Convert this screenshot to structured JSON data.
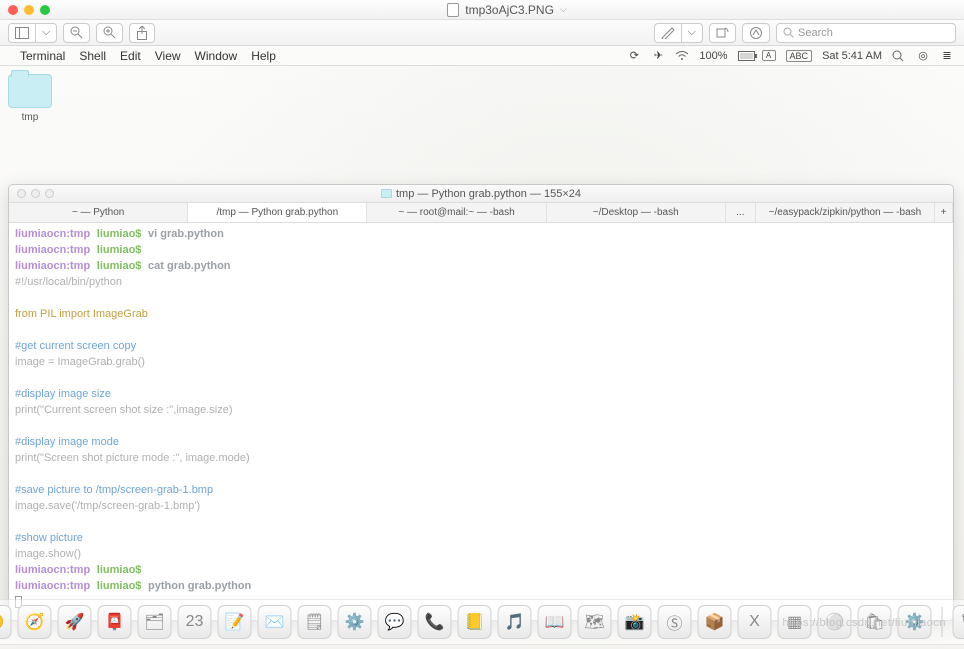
{
  "preview_window": {
    "title": "tmp3oAjC3.PNG",
    "search_placeholder": "Search"
  },
  "menubar": {
    "items": [
      "Terminal",
      "Shell",
      "Edit",
      "View",
      "Window",
      "Help"
    ],
    "battery": "100%",
    "input_badge": "ABC",
    "clock": "Sat 5:41 AM"
  },
  "desktop": {
    "folder_label": "tmp"
  },
  "terminal_window": {
    "title": "tmp — Python grab.python — 155×24",
    "tabs": [
      {
        "label": "~ — Python",
        "active": false
      },
      {
        "label": "/tmp — Python grab.python",
        "active": true
      },
      {
        "label": "~ — root@mail:~ — -bash",
        "active": false
      },
      {
        "label": "~/Desktop — -bash",
        "active": false
      },
      {
        "label": "...",
        "active": false
      },
      {
        "label": "~/easypack/zipkin/python — -bash",
        "active": false
      }
    ],
    "prompt": {
      "host_path": "liumiaocn:tmp",
      "user": "liumiao$"
    },
    "commands": {
      "vi": "vi grab.python",
      "cat": "cat grab.python",
      "run": "python grab.python"
    },
    "script_lines": [
      "#!/usr/local/bin/python",
      "",
      "from PIL import ImageGrab",
      "",
      "#get current screen copy",
      "image = ImageGrab.grab()",
      "",
      "#display image size",
      "print(\"Current screen shot size :\",image.size)",
      "",
      "#display image mode",
      "print(\"Screen shot picture mode :\", image.mode)",
      "",
      "#save picture to /tmp/screen-grab-1.bmp",
      "image.save('/tmp/screen-grab-1.bmp')",
      "",
      "#show picture",
      "image.show()"
    ]
  },
  "dock": {
    "tiles": [
      "😀",
      "🧭",
      "🚀",
      "📮",
      "🗂",
      "23",
      "📝",
      "✉️",
      "🗒",
      "⚙️",
      "💬",
      "📞",
      "📒",
      "🎵",
      "📖",
      "🗺",
      "📸",
      "Ⓢ",
      "📦",
      "X",
      "▦",
      "⚪",
      "🛍",
      "⚙️",
      "🗑"
    ],
    "calendar_day": "23"
  },
  "watermark": "https://blog.csdn.net/liumiaocn"
}
